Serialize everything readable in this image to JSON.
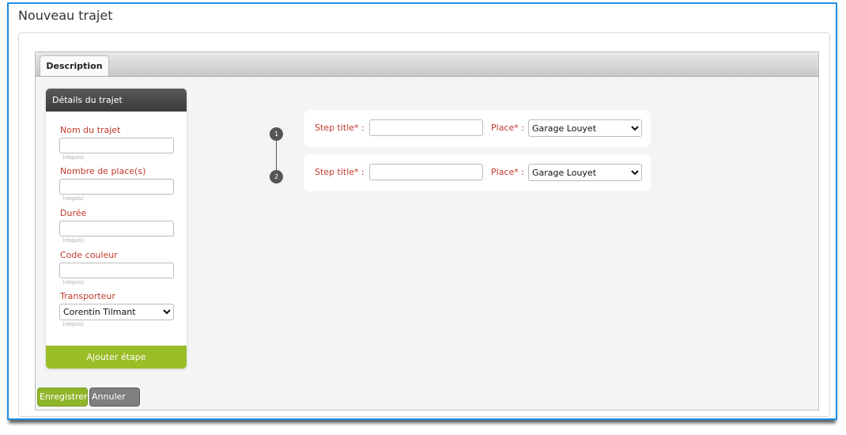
{
  "page": {
    "title": "Nouveau trajet"
  },
  "tabs": [
    {
      "label": "Description"
    }
  ],
  "details_card": {
    "title": "Détails du trajet",
    "fields": [
      {
        "label": "Nom du trajet",
        "value": "",
        "hint": "(requis)"
      },
      {
        "label": "Nombre de place(s)",
        "value": "",
        "hint": "(requis)"
      },
      {
        "label": "Durée",
        "value": "",
        "hint": "(requis)"
      },
      {
        "label": "Code couleur",
        "value": "",
        "hint": "(requis)"
      },
      {
        "label": "Transporteur",
        "value": "Corentin Tilmant",
        "hint": "(requis)"
      }
    ],
    "add_step_label": "Ajouter étape"
  },
  "steps": [
    {
      "number": "1",
      "title_label": "Step title* :",
      "title_value": "",
      "place_label": "Place* :",
      "place_value": "Garage Louyet"
    },
    {
      "number": "2",
      "title_label": "Step title* :",
      "title_value": "",
      "place_label": "Place* :",
      "place_value": "Garage Louyet"
    }
  ],
  "actions": {
    "save_label": "Enregistrer",
    "cancel_label": "Annuler"
  },
  "colors": {
    "accent_green": "#9bbd27",
    "label_red": "#c0392b",
    "window_border": "#1f8fe0"
  }
}
